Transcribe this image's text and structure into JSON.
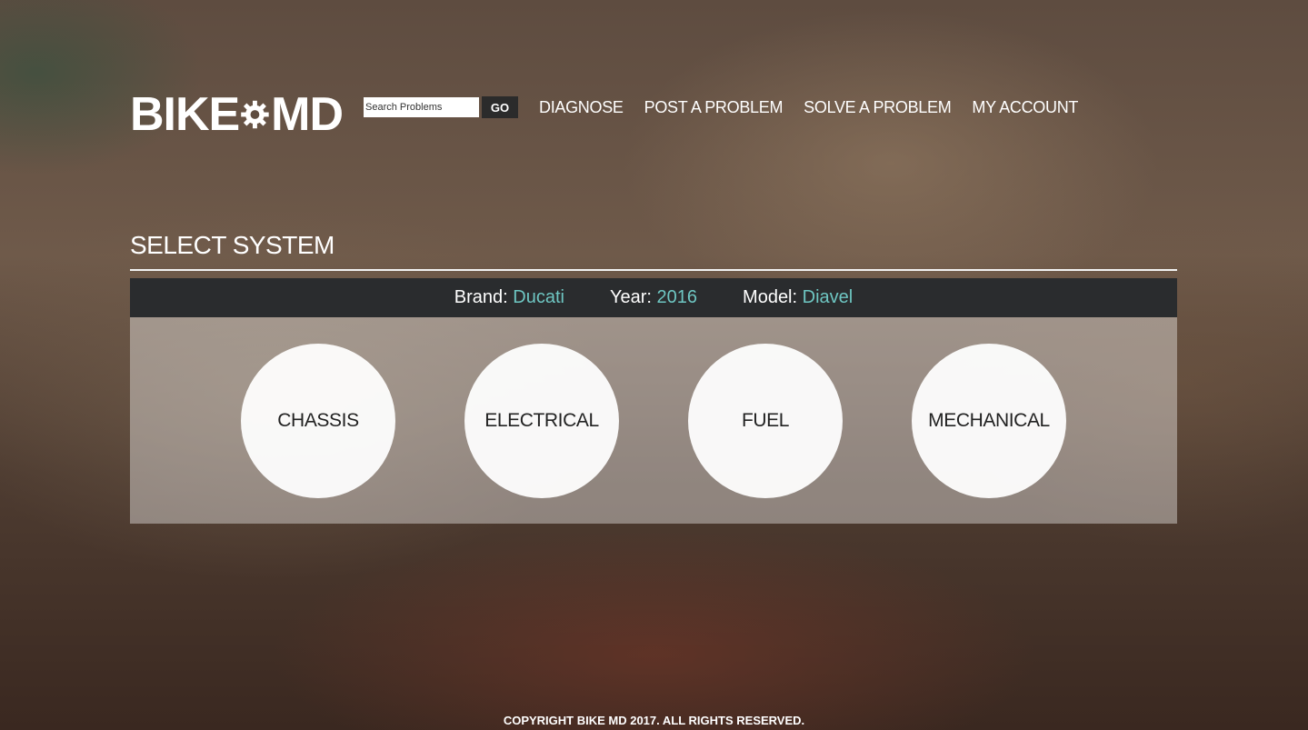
{
  "header": {
    "logo_text_left": "BIKE",
    "logo_text_right": "MD",
    "search_placeholder": "Search Problems",
    "search_value": "",
    "go_label": "GO",
    "nav": [
      {
        "label": "DIAGNOSE"
      },
      {
        "label": "POST A PROBLEM"
      },
      {
        "label": "SOLVE A PROBLEM"
      },
      {
        "label": "MY ACCOUNT"
      }
    ]
  },
  "main": {
    "title": "SELECT SYSTEM",
    "info": {
      "brand_label": "Brand:",
      "brand_value": "Ducati",
      "year_label": "Year:",
      "year_value": "2016",
      "model_label": "Model:",
      "model_value": "Diavel"
    },
    "systems": [
      {
        "label": "CHASSIS"
      },
      {
        "label": "ELECTRICAL"
      },
      {
        "label": "FUEL"
      },
      {
        "label": "MECHANICAL"
      }
    ]
  },
  "footer": {
    "copyright": "COPYRIGHT BIKE MD 2017. ALL RIGHTS RESERVED."
  },
  "colors": {
    "accent_teal": "#6ec6c2",
    "info_bar_bg": "#2a2c2e",
    "go_button_bg": "#2b2b2b",
    "text_white": "#ffffff"
  }
}
